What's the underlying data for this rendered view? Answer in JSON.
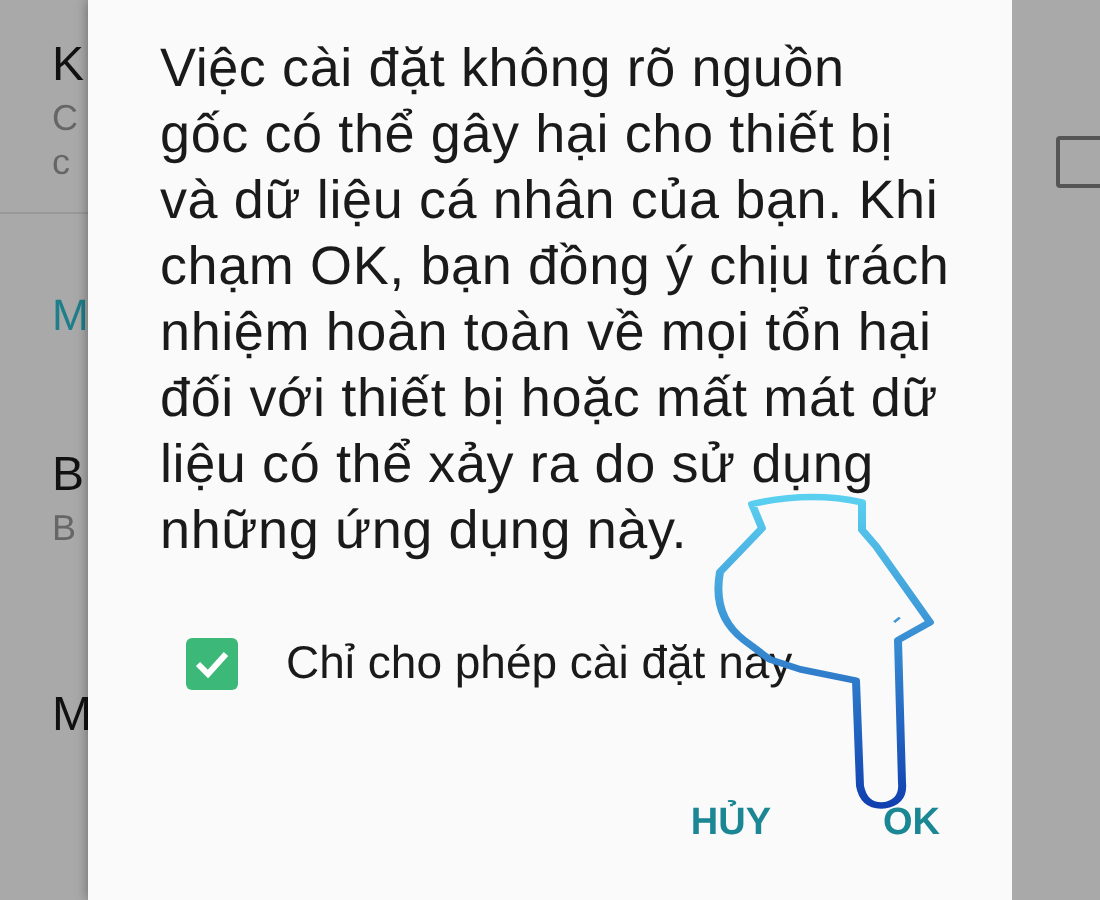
{
  "background_settings": {
    "items": [
      {
        "kind": "title",
        "text": "K"
      },
      {
        "kind": "subtitle",
        "text": "C"
      },
      {
        "kind": "subtitle",
        "text": "c"
      },
      {
        "kind": "divider"
      },
      {
        "kind": "header",
        "text": "M"
      },
      {
        "kind": "title",
        "text": "B"
      },
      {
        "kind": "subtitle",
        "text": "B"
      },
      {
        "kind": "title",
        "text": "M"
      }
    ]
  },
  "background_right": {
    "checkbox": {
      "checked": false
    }
  },
  "dialog": {
    "message": "Việc cài đặt không rõ nguồn\ngốc có thể gây hại cho thiết bị\nvà dữ liệu cá nhân của bạn. Khi\nchạm OK, bạn đồng ý chịu trách\nnhiệm hoàn toàn về mọi tổn hại\nđối với thiết bị hoặc mất mát dữ\nliệu có thể xảy ra do sử dụng\nnhững ứng dụng này.",
    "checkbox": {
      "label": "Chỉ cho phép cài đặt này",
      "checked": true
    },
    "buttons": [
      "HỦY",
      "OK"
    ]
  }
}
